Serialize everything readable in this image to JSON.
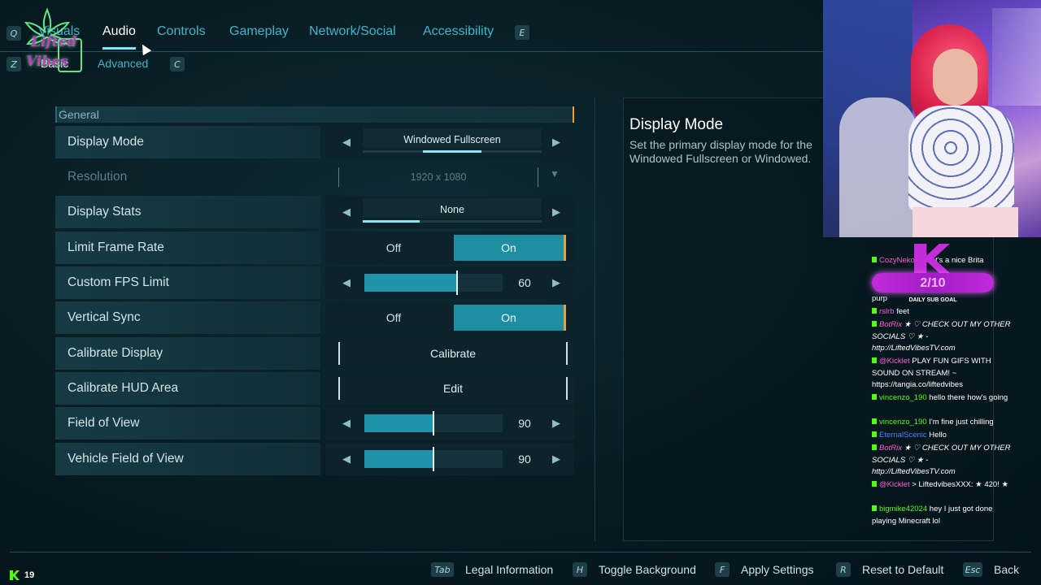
{
  "top_tabs": {
    "left_key": "Q",
    "right_key": "E",
    "items": [
      {
        "label": "Visuals"
      },
      {
        "label": "Audio"
      },
      {
        "label": "Controls"
      },
      {
        "label": "Gameplay"
      },
      {
        "label": "Network/Social"
      },
      {
        "label": "Accessibility"
      }
    ]
  },
  "sub_tabs": {
    "left_key": "Z",
    "right_key": "C",
    "basic": "Basic",
    "advanced": "Advanced"
  },
  "logo": {
    "line1": "Lifted",
    "line2": "Vibes"
  },
  "section": {
    "title": "General"
  },
  "settings": [
    {
      "label": "Display Mode",
      "type": "selector",
      "value": "Windowed Fullscreen",
      "position_fraction": 0.5
    },
    {
      "label": "Resolution",
      "type": "dropdown",
      "value": "1920 x 1080",
      "disabled": true
    },
    {
      "label": "Display Stats",
      "type": "selector",
      "value": "None",
      "position_fraction": 0.0
    },
    {
      "label": "Limit Frame Rate",
      "type": "toggle",
      "off_label": "Off",
      "on_label": "On",
      "value": "On"
    },
    {
      "label": "Custom FPS Limit",
      "type": "slider",
      "value": "60",
      "fill_fraction": 0.67
    },
    {
      "label": "Vertical Sync",
      "type": "toggle",
      "off_label": "Off",
      "on_label": "On",
      "value": "On"
    },
    {
      "label": "Calibrate Display",
      "type": "button",
      "button_label": "Calibrate"
    },
    {
      "label": "Calibrate HUD Area",
      "type": "button",
      "button_label": "Edit"
    },
    {
      "label": "Field of View",
      "type": "slider",
      "value": "90",
      "fill_fraction": 0.5
    },
    {
      "label": "Vehicle Field of View",
      "type": "slider",
      "value": "90",
      "fill_fraction": 0.5
    }
  ],
  "description": {
    "title": "Display Mode",
    "line1": "Set the primary display mode for the",
    "line2": "Windowed Fullscreen or Windowed."
  },
  "chat": {
    "goal_count": "2/10",
    "goal_label": "DAILY SUB GOAL",
    "messages": [
      {
        "user": "CozyNeko",
        "user_color": "#ff5fd2",
        "text": "w that's a nice Brita"
      },
      {
        "user": "",
        "user_color": "#ffffff",
        "text": "purp"
      },
      {
        "user": "rslrb",
        "user_color": "#ff5fd2",
        "text": "feet"
      },
      {
        "user": "BotRix",
        "user_color": "#ff5fd2",
        "text": "★ ♡ CHECK OUT MY OTHER SOCIALS ♡ ★ - http://LiftedVibesTV.com"
      },
      {
        "user": "@Kicklet",
        "user_color": "#ff5fd2",
        "text": "PLAY FUN GIFS WITH SOUND ON STREAM! ~ https://tangia.co/liftedvibes"
      },
      {
        "user": "vincenzo_190",
        "user_color": "#53fc18",
        "text": "hello there how's going"
      },
      {
        "user": "vincenzo_190",
        "user_color": "#53fc18",
        "text": "I'm fine just chilling"
      },
      {
        "user": "EternalScenic",
        "user_color": "#4c84ff",
        "text": "Hello"
      },
      {
        "user": "BotRix",
        "user_color": "#ff5fd2",
        "text": "★ ♡ CHECK OUT MY OTHER SOCIALS ♡ ★ - http://LiftedVibesTV.com"
      },
      {
        "user": "@Kicklet",
        "user_color": "#ff5fd2",
        "text": "> LiftedvibesXXX: ★ 420! ★"
      },
      {
        "user": "bigmike42024",
        "user_color": "#53fc18",
        "text": "hey I just got done playing Minecraft lol"
      }
    ]
  },
  "bottom_bar": [
    {
      "key": "Tab",
      "label": "Legal Information"
    },
    {
      "key": "H",
      "label": "Toggle Background"
    },
    {
      "key": "F",
      "label": "Apply Settings"
    },
    {
      "key": "R",
      "label": "Reset to Default"
    },
    {
      "key": "Esc",
      "label": "Back"
    }
  ],
  "viewer_count": "19",
  "colors": {
    "accent": "#1e93a9",
    "highlight": "#e8a33a",
    "tab_inactive": "#3fb6cc",
    "kick_green": "#53fc18"
  }
}
